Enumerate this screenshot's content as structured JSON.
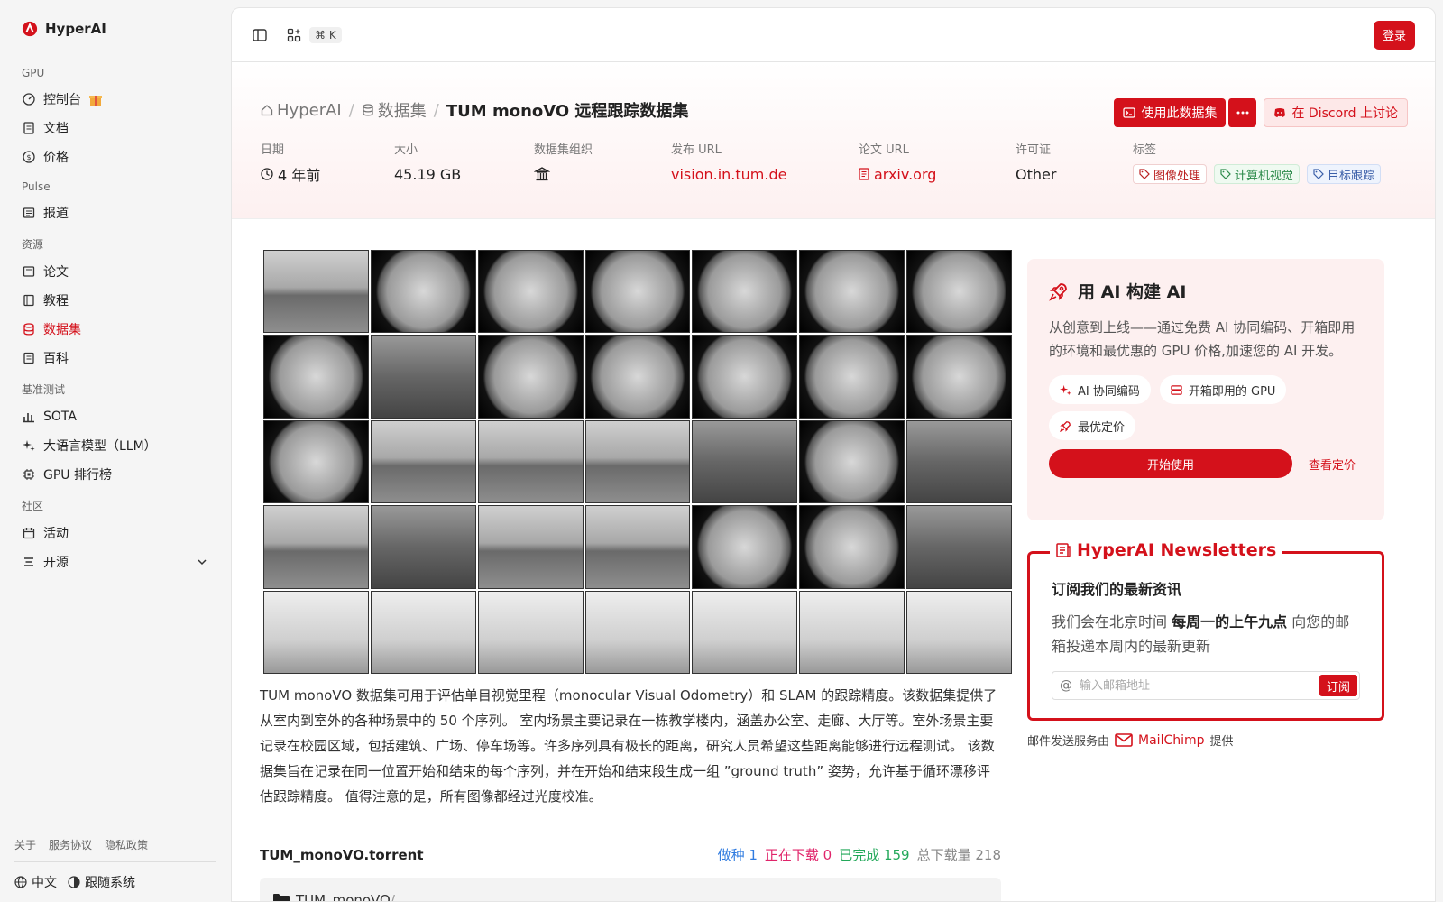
{
  "app": {
    "name": "HyperAI"
  },
  "sidebar": {
    "sections": [
      {
        "title": "GPU",
        "items": [
          {
            "label": "控制台"
          },
          {
            "label": "文档"
          },
          {
            "label": "价格"
          }
        ]
      },
      {
        "title": "Pulse",
        "items": [
          {
            "label": "报道"
          }
        ]
      },
      {
        "title": "资源",
        "items": [
          {
            "label": "论文"
          },
          {
            "label": "教程"
          },
          {
            "label": "数据集"
          },
          {
            "label": "百科"
          }
        ]
      },
      {
        "title": "基准测试",
        "items": [
          {
            "label": "SOTA"
          },
          {
            "label": "大语言模型（LLM）"
          },
          {
            "label": "GPU 排行榜"
          }
        ]
      },
      {
        "title": "社区",
        "items": [
          {
            "label": "活动"
          },
          {
            "label": "开源"
          }
        ]
      }
    ],
    "footer_links": [
      "关于",
      "服务协议",
      "隐私政策"
    ],
    "language": "中文",
    "theme": "跟随系统"
  },
  "topbar": {
    "shortcut": "⌘ K",
    "login": "登录"
  },
  "header": {
    "breadcrumb": [
      "HyperAI",
      "数据集",
      "TUM monoVO 远程跟踪数据集"
    ],
    "use_dataset": "使用此数据集",
    "discord": "在 Discord 上讨论",
    "meta": {
      "date_label": "日期",
      "date_value": "4 年前",
      "size_label": "大小",
      "size_value": "45.19 GB",
      "org_label": "数据集组织",
      "url_label": "发布 URL",
      "url_value": "vision.in.tum.de",
      "paper_label": "论文 URL",
      "paper_value": "arxiv.org",
      "license_label": "许可证",
      "license_value": "Other",
      "tags_label": "标签",
      "tags": [
        "图像处理",
        "计算机视觉",
        "目标跟踪"
      ]
    }
  },
  "content": {
    "description": "TUM monoVO 数据集可用于评估单目视觉里程（monocular Visual Odometry）和 SLAM 的跟踪精度。该数据集提供了从室内到室外的各种场景中的 50 个序列。 室内场景主要记录在一栋教学楼内，涵盖办公室、走廊、大厅等。室外场景主要记录在校园区域，包括建筑、广场、停车场等。许多序列具有极长的距离，研究人员希望这些距离能够进行远程测试。 该数据集旨在记录在同一位置开始和结束的每个序列，并在开始和结束段生成一组 ”ground truth” 姿势，允许基于循环漂移评估跟踪精度。 值得注意的是，所有图像都经过光度校准。",
    "torrent": {
      "name": "TUM_monoVO.torrent",
      "seeding": "做种 1",
      "downloading": "正在下载 0",
      "completed": "已完成 159",
      "total": "总下载量 218"
    },
    "folder": "TUM_monoVO",
    "folder_sep": "/"
  },
  "promo": {
    "title": "用 AI 构建 AI",
    "description": "从创意到上线——通过免费 AI 协同编码、开箱即用的环境和最优惠的 GPU 价格,加速您的 AI 开发。",
    "chips": [
      "AI 协同编码",
      "开箱即用的 GPU",
      "最优定价"
    ],
    "start": "开始使用",
    "pricing": "查看定价"
  },
  "newsletter": {
    "title": "HyperAI Newsletters",
    "subtitle": "订阅我们的最新资讯",
    "desc_before": "我们会在北京时间",
    "desc_bold": "每周一的上午九点",
    "desc_after": "向您的邮箱投递本周内的最新更新",
    "placeholder": "输入邮箱地址",
    "subscribe": "订阅",
    "mc_prefix": "邮件发送服务由",
    "mc_name": "MailChimp",
    "mc_suffix": "提供"
  },
  "colors": {
    "accent": "#d4111b",
    "sidebar_bg": "#f5f5f5"
  },
  "gallery": {
    "styles": [
      "wide",
      "fish",
      "fish",
      "fish",
      "fish",
      "fish",
      "fish",
      "fish",
      "dark",
      "fish",
      "fish",
      "fish",
      "fish",
      "fish",
      "fish",
      "wide",
      "wide",
      "wide",
      "dark",
      "fish",
      "dark",
      "wide",
      "dark",
      "wide",
      "wide",
      "fish",
      "fish",
      "dark",
      "light",
      "light",
      "light",
      "light",
      "light",
      "light",
      "light"
    ]
  }
}
